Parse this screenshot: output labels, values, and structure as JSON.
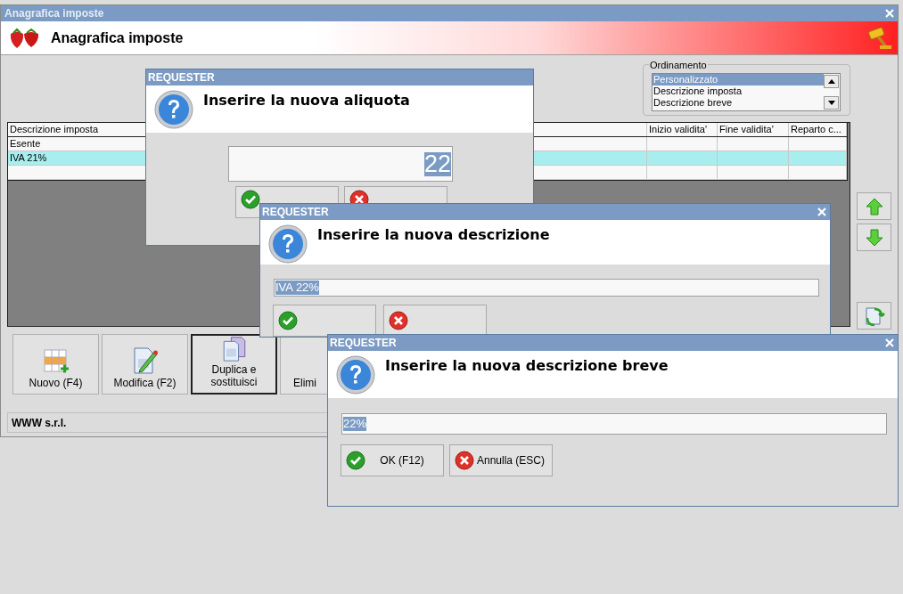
{
  "window": {
    "title": "Anagrafica imposte",
    "header_title": "Anagrafica imposte"
  },
  "sort_group": {
    "label": "Ordinamento",
    "options": [
      {
        "label": "Personalizzato",
        "selected": true
      },
      {
        "label": "Descrizione imposta",
        "selected": false
      },
      {
        "label": "Descrizione breve",
        "selected": false
      }
    ]
  },
  "table": {
    "columns": [
      "Descrizione imposta",
      "Inizio validita'",
      "Fine validita'",
      "Reparto c..."
    ],
    "rows": [
      {
        "cells": [
          "Esente"
        ],
        "selected": false
      },
      {
        "cells": [
          "IVA 21%"
        ],
        "selected": true
      },
      {
        "cells": [],
        "selected": false
      }
    ]
  },
  "actions": [
    {
      "label": "Nuovo (F4)",
      "kind": "new",
      "focused": false
    },
    {
      "label": "Modifica (F2)",
      "kind": "edit",
      "focused": false
    },
    {
      "label": "Duplica e sostituisci",
      "kind": "duplicate",
      "focused": true
    },
    {
      "label": "Elimi",
      "kind": "delete",
      "focused": false
    }
  ],
  "status_bar": "WWW s.r.l.",
  "dialogs": [
    {
      "title": "REQUESTER",
      "prompt": "Inserire la nuova aliquota",
      "value": "22",
      "kind": "number",
      "closable": false,
      "buttons": [
        {
          "kind": "ok"
        },
        {
          "kind": "cancel"
        }
      ]
    },
    {
      "title": "REQUESTER",
      "prompt": "Inserire la nuova descrizione",
      "value": "IVA 22%",
      "kind": "text",
      "closable": true,
      "buttons": [
        {
          "kind": "ok"
        },
        {
          "kind": "cancel"
        }
      ]
    },
    {
      "title": "REQUESTER",
      "prompt": "Inserire la nuova descrizione breve",
      "value": "22%",
      "kind": "text",
      "closable": true,
      "buttons": [
        {
          "kind": "ok",
          "label": "OK (F12)"
        },
        {
          "kind": "cancel",
          "label": "Annulla (ESC)"
        }
      ]
    }
  ]
}
